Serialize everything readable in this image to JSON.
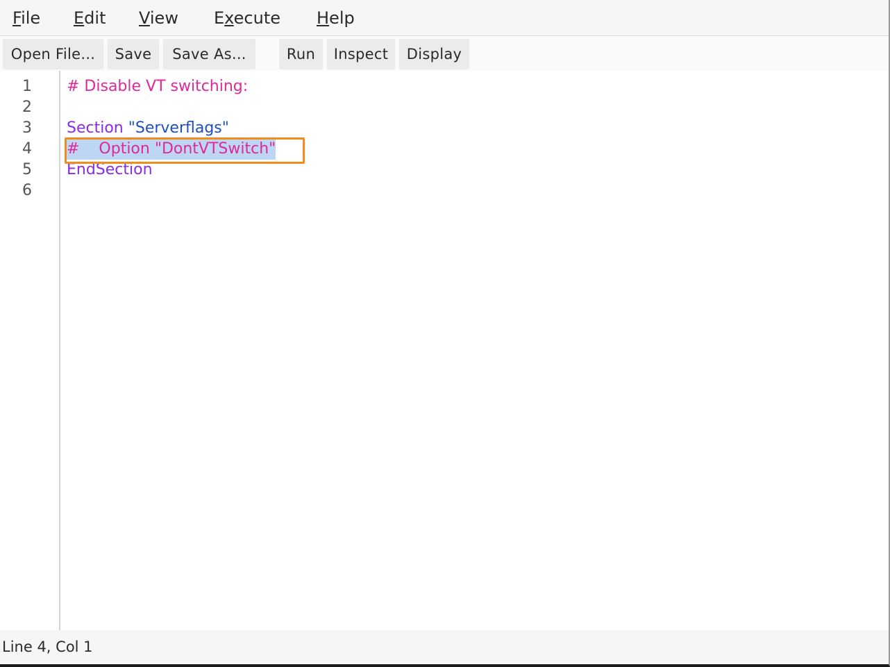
{
  "menubar": {
    "items": [
      {
        "label_pre": "",
        "mnemonic": "F",
        "label_post": "ile"
      },
      {
        "label_pre": "",
        "mnemonic": "E",
        "label_post": "dit"
      },
      {
        "label_pre": "",
        "mnemonic": "V",
        "label_post": "iew"
      },
      {
        "label_pre": "E",
        "mnemonic": "x",
        "label_post": "ecute"
      },
      {
        "label_pre": "",
        "mnemonic": "H",
        "label_post": "elp"
      }
    ]
  },
  "toolbar": {
    "open_label": "Open File...",
    "save_label": "Save",
    "save_as_label": "Save As...",
    "run_label": "Run",
    "inspect_label": "Inspect",
    "display_label": "Display"
  },
  "editor": {
    "line_numbers": [
      "1",
      "2",
      "3",
      "4",
      "5",
      "6"
    ],
    "lines": {
      "l1": "# Disable VT switching:",
      "l2": "",
      "l3_kw": "Section",
      "l3_str": " \"Serverflags\"",
      "l4": "#    Option \"DontVTSwitch\"",
      "l5": "EndSection",
      "l6": ""
    },
    "selected_line": 4
  },
  "statusbar": {
    "position": "Line 4, Col 1"
  },
  "colors": {
    "keyword": "#8a2be2",
    "string": "#1f4fbf",
    "comment": "#e0289a",
    "selection": "#bcd6f4",
    "highlight_box": "#f28c1e"
  }
}
